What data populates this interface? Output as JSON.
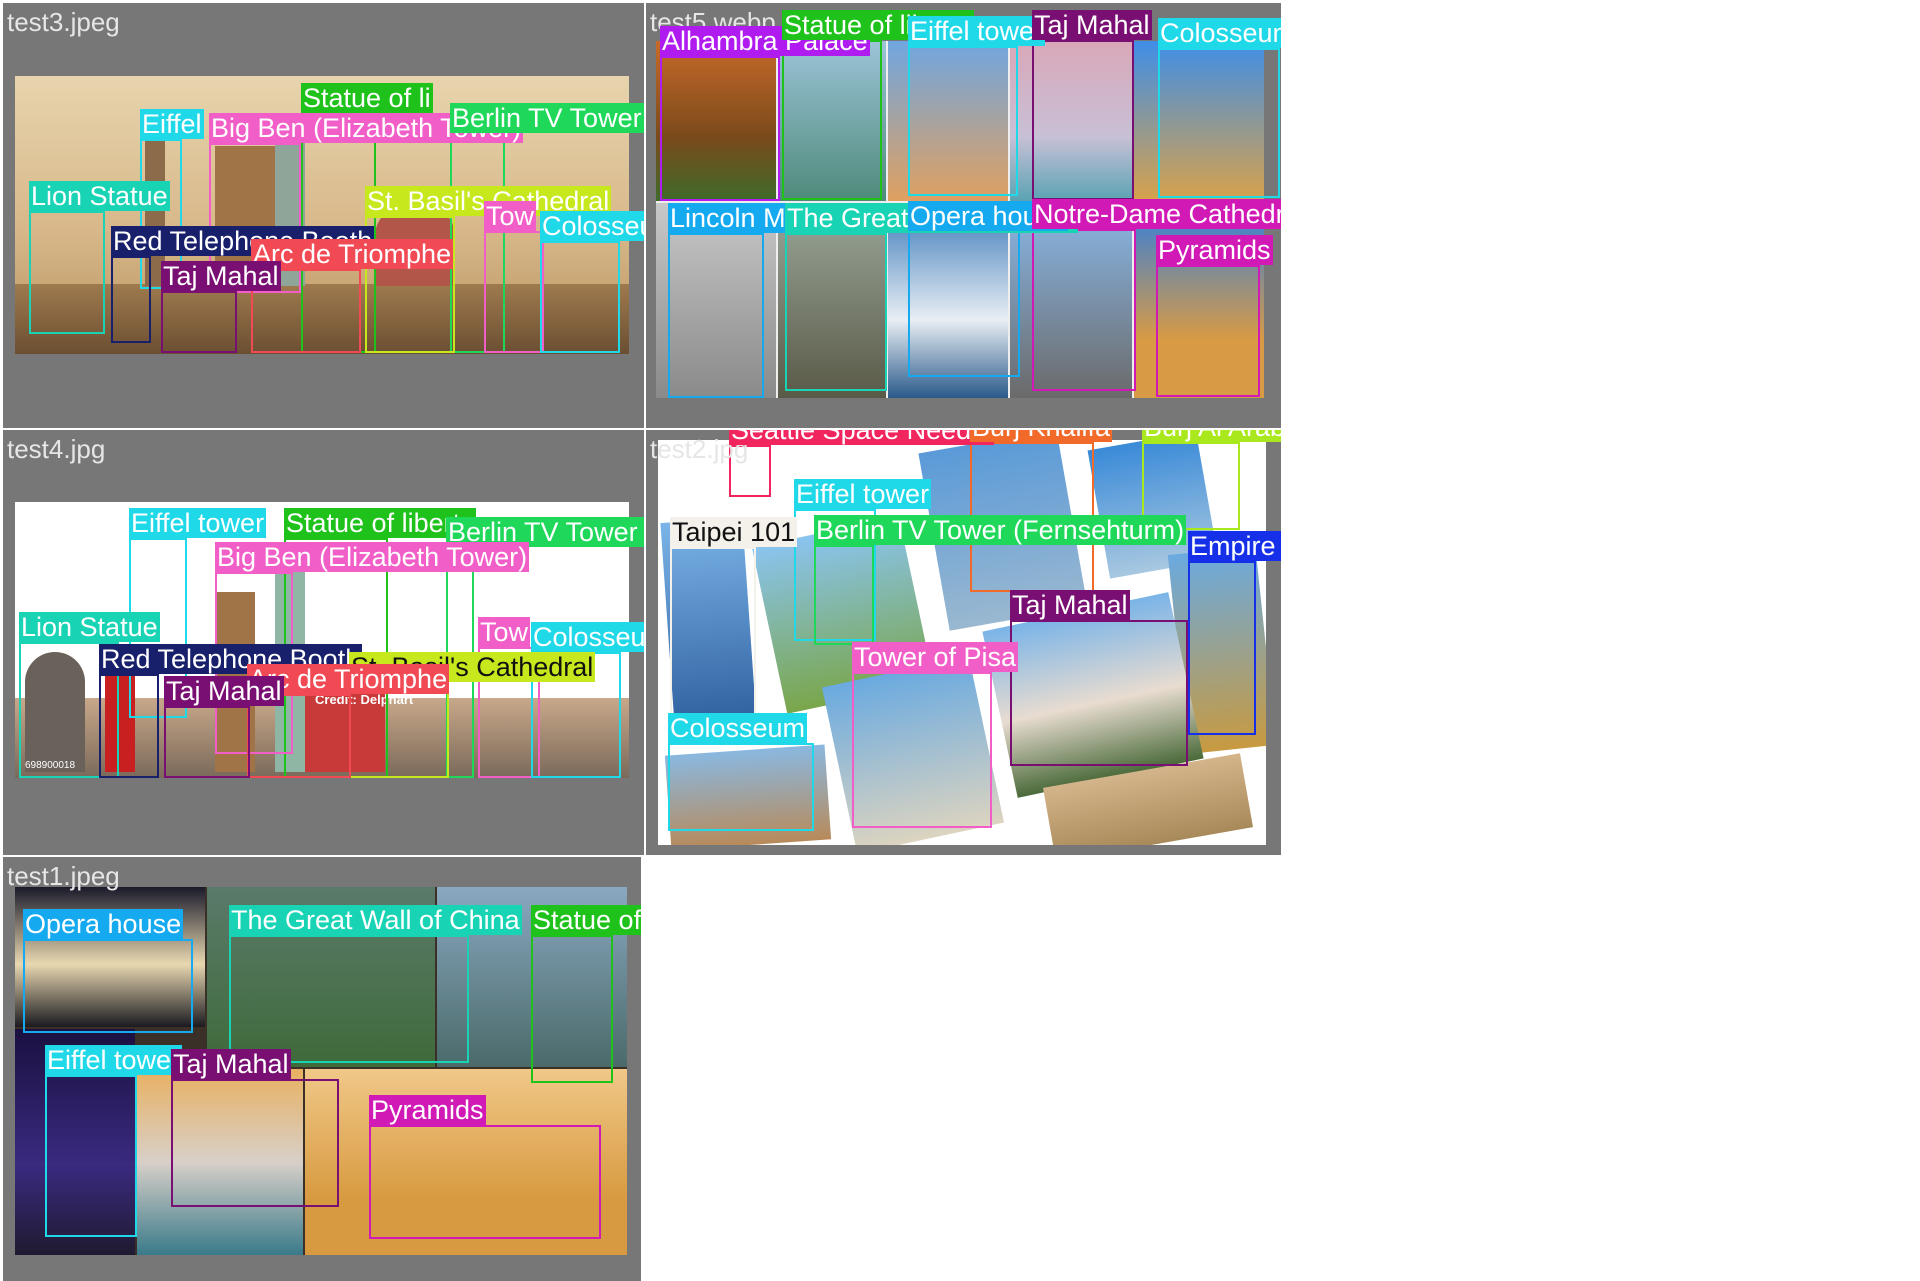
{
  "panels": [
    {
      "filename": "test3.jpeg",
      "detections": [
        {
          "label": "Eiffel",
          "color": "#1fd8e8"
        },
        {
          "label": "Statue of li",
          "color": "#1fc21a"
        },
        {
          "label": "Big Ben (Elizabeth Tower)",
          "color": "#f25ec8"
        },
        {
          "label": "Berlin TV Tower (Fernsehturm)",
          "color": "#1fd85a"
        },
        {
          "label": "Lion Statue",
          "color": "#19d3b5"
        },
        {
          "label": "St. Basil's Cathedral",
          "color": "#c6e81c"
        },
        {
          "label": "Tow",
          "color": "#f25ec8"
        },
        {
          "label": "Colosseum",
          "color": "#1fd8e8"
        },
        {
          "label": "Red Telephone Booth",
          "color": "#18206b"
        },
        {
          "label": "Arc de Triomphe",
          "color": "#f24a55"
        },
        {
          "label": "Taj Mahal",
          "color": "#7a0f73"
        }
      ]
    },
    {
      "filename": "test5.webp",
      "detections": [
        {
          "label": "Alhambra Palace",
          "color": "#b01cf0"
        },
        {
          "label": "Statue of liberty",
          "color": "#1fc21a"
        },
        {
          "label": "Eiffel tower",
          "color": "#1fd8e8"
        },
        {
          "label": "Taj Mahal",
          "color": "#7a0f73"
        },
        {
          "label": "Colosseum",
          "color": "#1fd8e8"
        },
        {
          "label": "Lincoln Memorial",
          "color": "#15a9f0"
        },
        {
          "label": "The Great Wall of China",
          "color": "#19d3b5"
        },
        {
          "label": "Opera house",
          "color": "#15a9f0"
        },
        {
          "label": "Notre-Dame Cathedral",
          "color": "#d019b5"
        },
        {
          "label": "Pyramids",
          "color": "#d019b5"
        }
      ]
    },
    {
      "filename": "test4.jpg",
      "credit_text": "Credit: Delphart",
      "stock_id": "698900018",
      "detections": [
        {
          "label": "Eiffel tower",
          "color": "#1fd8e8"
        },
        {
          "label": "Statue of liberty",
          "color": "#1fc21a"
        },
        {
          "label": "Berlin TV Tower (Fernsehturm)",
          "color": "#1fd85a"
        },
        {
          "label": "Big Ben (Elizabeth Tower)",
          "color": "#f25ec8"
        },
        {
          "label": "Lion Statue",
          "color": "#19d3b5"
        },
        {
          "label": "Tow",
          "color": "#f25ec8"
        },
        {
          "label": "Colosseum",
          "color": "#1fd8e8"
        },
        {
          "label": "Red Telephone Booth",
          "color": "#18206b"
        },
        {
          "label": "St. Basil's Cathedral",
          "color": "#c6e81c"
        },
        {
          "label": "Arc de Triomphe",
          "color": "#f24a55"
        },
        {
          "label": "Taj Mahal",
          "color": "#7a0f73"
        }
      ]
    },
    {
      "filename": "test2.jpg",
      "detections": [
        {
          "label": "Seattle Space Needle",
          "color": "#f2265e"
        },
        {
          "label": "Burj Khalifa",
          "color": "#f26a2a"
        },
        {
          "label": "Burj Al Arab",
          "color": "#a8e81c"
        },
        {
          "label": "Eiffel tower",
          "color": "#1fd8e8"
        },
        {
          "label": "Berlin TV Tower (Fernsehturm)",
          "color": "#1fd85a"
        },
        {
          "label": "Taipei 101",
          "color": "#f4f0ea"
        },
        {
          "label": "Empire State building",
          "color": "#1530e8"
        },
        {
          "label": "Taj Mahal",
          "color": "#7a0f73"
        },
        {
          "label": "Tower of Pisa",
          "color": "#f25ec8"
        },
        {
          "label": "Colosseum",
          "color": "#1fd8e8"
        }
      ]
    },
    {
      "filename": "test1.jpeg",
      "detections": [
        {
          "label": "Opera house",
          "color": "#15a9f0"
        },
        {
          "label": "The Great Wall of China",
          "color": "#19d3b5"
        },
        {
          "label": "Statue of liberty",
          "color": "#1fc21a"
        },
        {
          "label": "Eiffel tower",
          "color": "#1fd8e8"
        },
        {
          "label": "Taj Mahal",
          "color": "#7a0f73"
        },
        {
          "label": "Pyramids",
          "color": "#d019b5"
        }
      ]
    }
  ]
}
